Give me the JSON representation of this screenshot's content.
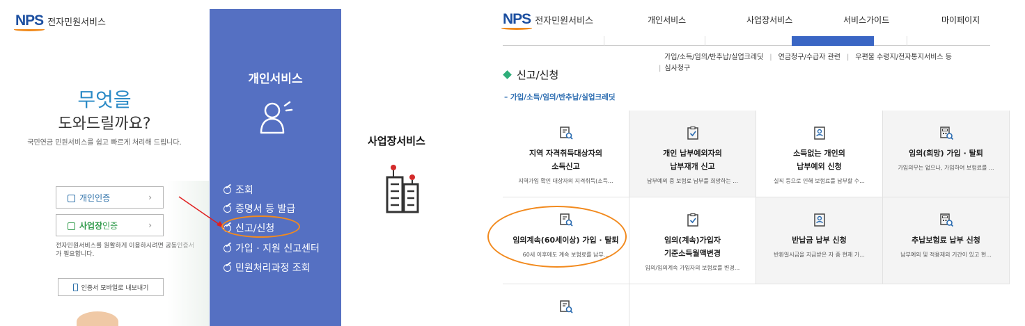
{
  "left": {
    "logo": {
      "mark": "NPS",
      "text": "전자민원서비스"
    },
    "hero": {
      "line1": "무엇을",
      "line2": "도와드릴까요?",
      "desc": "국민연금 민원서비스를 쉽고 빠르게 처리해 드립니다."
    },
    "cert": {
      "personal": {
        "bold": "개인",
        "rest": " 인증",
        "chevron": "›"
      },
      "business": {
        "bold": "사업장",
        "rest": " 인증",
        "chevron": "›"
      },
      "desc": "전자민원서비스를 원활하게 이용하시려면 공동인증서가 필요합니다.",
      "mobile": "인증서 모바일로 내보내기"
    },
    "menu": {
      "title": "개인서비스",
      "items": [
        "조회",
        "증명서 등 발급",
        "신고/신청",
        "가입 · 지원 신고센터",
        "민원처리과정 조회"
      ]
    },
    "business_service": {
      "title": "사업장서비스"
    }
  },
  "right": {
    "logo": {
      "mark": "NPS",
      "text": "전자민원서비스"
    },
    "gnb": [
      "개인서비스",
      "사업장서비스",
      "서비스가이드",
      "마이페이지"
    ],
    "breadcrumbs": {
      "line1": [
        "가입/소득/임의/반추납/실업크레딧",
        "연금청구/수급자 관련",
        "우편물 수령지/전자통지서비스 등"
      ],
      "line2": "심사청구"
    },
    "page_title": "신고/신청",
    "section_title": "– 가입/소득/임의/반추납/실업크레딧",
    "cards": [
      {
        "title1": "지역 자격취득대상자의",
        "title2": "소득신고",
        "desc": "지역가입 확인 대상자의 지격취득(소득...",
        "icon": "document-search-icon"
      },
      {
        "title1": "개인 납부예외자의",
        "title2": "납부재개 신고",
        "desc": "납부예외 중 보험료 납부를 희망하는 ...",
        "icon": "clipboard-check-icon"
      },
      {
        "title1": "소득없는 개인의",
        "title2": "납부예외 신청",
        "desc": "실직 등으로 인해 보험료를 납부할 수...",
        "icon": "id-badge-icon"
      },
      {
        "title1": "임의(희망) 가입 · 탈퇴",
        "title2": "",
        "desc": "가입의무는 없으나, 가입하여 보험료를 ...",
        "icon": "calculator-search-icon"
      },
      {
        "title1": "임의계속(60세이상) 가입 · 탈퇴",
        "title2": "",
        "desc": "60세 이후에도 계속 보험료를 납부...",
        "icon": "document-search-icon"
      },
      {
        "title1": "임의(계속)가입자",
        "title2": "기준소득월액변경",
        "desc": "임의/임의계속 가입자의 보험료를 변경...",
        "icon": "clipboard-check-icon"
      },
      {
        "title1": "반납금 납부 신청",
        "title2": "",
        "desc": "반환일시금을 지급받은 자 중 현재 가...",
        "icon": "id-badge-icon"
      },
      {
        "title1": "추납보험료 납부 신청",
        "title2": "",
        "desc": "납부예외 및 적용제외 기간이 있고 현...",
        "icon": "calculator-search-icon"
      }
    ]
  },
  "colors": {
    "menu_blue": "#5570c2",
    "highlight_orange": "#f28a1e",
    "arrow_red": "#e02020",
    "brand_blue": "#1c4fa0"
  }
}
